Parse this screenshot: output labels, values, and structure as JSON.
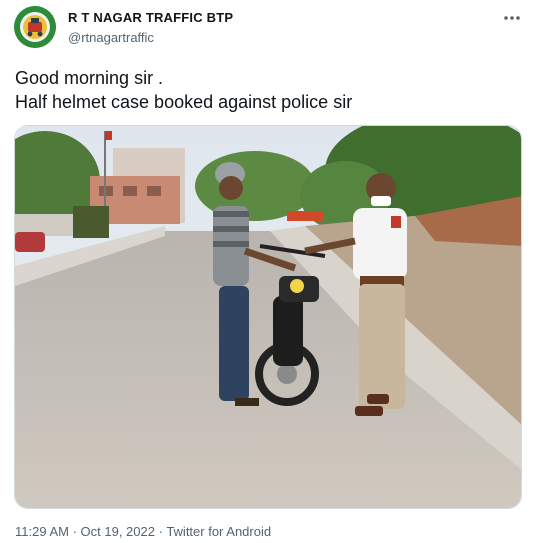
{
  "tweet": {
    "author": {
      "display_name": "R T NAGAR TRAFFIC BTP",
      "handle": "@rtnagartraffic",
      "avatar_icon": "police-emblem-icon"
    },
    "more_icon": "more-horizontal-icon",
    "text_lines": [
      "Good morning sir .",
      "Half helmet case booked against police sir"
    ],
    "media": {
      "type": "photo",
      "alt": ""
    },
    "meta": {
      "time": "11:29 AM",
      "separator": " · ",
      "date": "Oct 19, 2022",
      "source": "Twitter for Android"
    }
  },
  "colors": {
    "text": "#0f1419",
    "muted": "#536471",
    "border": "#cfd9de",
    "avatar_bg": "#2e8b3a"
  }
}
